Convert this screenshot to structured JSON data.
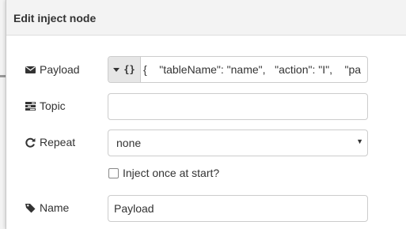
{
  "dialog": {
    "title": "Edit inject node"
  },
  "payload": {
    "label": "Payload",
    "icon": "envelope-icon",
    "type_label": "{}",
    "value": "{    \"tableName\": \"name\",   \"action\": \"I\",    \"pa"
  },
  "topic": {
    "label": "Topic",
    "icon": "tasks-icon",
    "value": ""
  },
  "repeat": {
    "label": "Repeat",
    "icon": "repeat-icon",
    "selected": "none"
  },
  "inject_once": {
    "label": "Inject once at start?",
    "checked": false
  },
  "name": {
    "label": "Name",
    "icon": "tag-icon",
    "value": "Payload"
  }
}
